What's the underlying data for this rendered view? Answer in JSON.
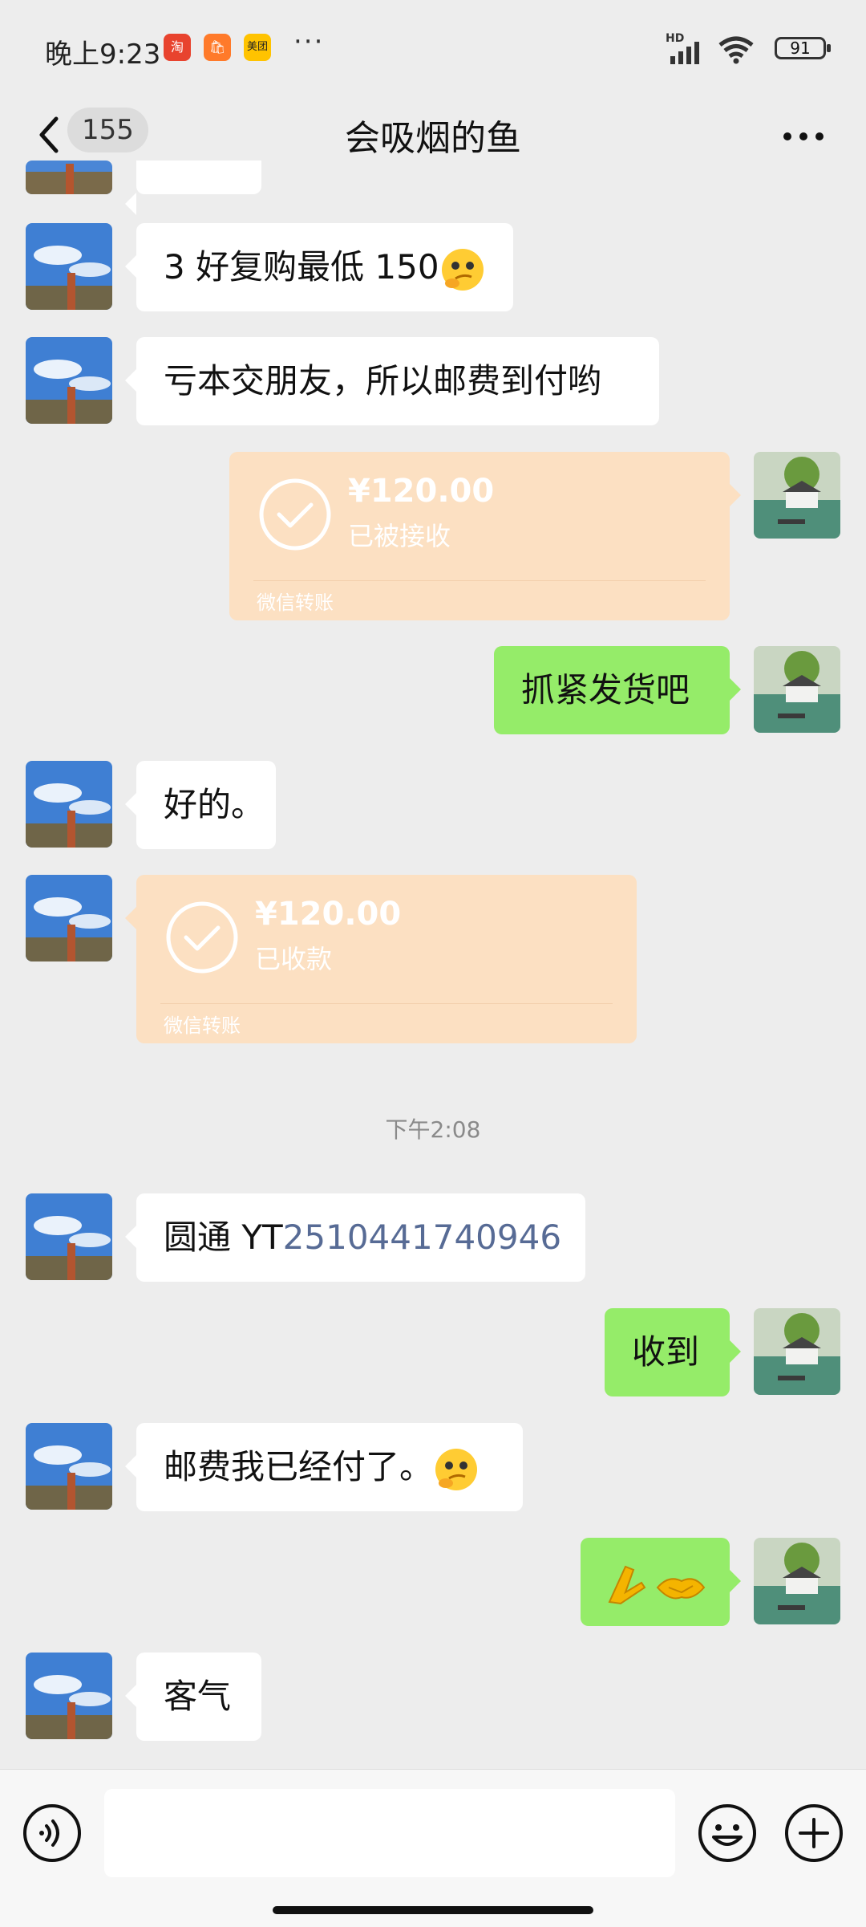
{
  "status_bar": {
    "time": "晚上9:23",
    "apps": [
      "淘",
      "🛍",
      "美团"
    ],
    "network": "HD",
    "battery": "91"
  },
  "nav": {
    "unread_count": "155",
    "title": "会吸烟的鱼"
  },
  "messages": [
    {
      "side": "left",
      "type": "text",
      "text": "3 好复购最低 150",
      "emoji": "smirk-emoji"
    },
    {
      "side": "left",
      "type": "text",
      "text": "亏本交朋友，所以邮费到付哟"
    },
    {
      "side": "right",
      "type": "transfer",
      "amount": "¥120.00",
      "status": "已被接收",
      "label": "微信转账"
    },
    {
      "side": "right",
      "type": "text",
      "text": "抓紧发货吧"
    },
    {
      "side": "left",
      "type": "text",
      "text": "好的。"
    },
    {
      "side": "left",
      "type": "transfer",
      "amount": "¥120.00",
      "status": "已收款",
      "label": "微信转账"
    },
    {
      "side": "left",
      "type": "text",
      "text_prefix": "圆通 YT",
      "link": "2510441740946"
    },
    {
      "side": "right",
      "type": "text",
      "text": "收到"
    },
    {
      "side": "left",
      "type": "text",
      "text": "邮费我已经付了。",
      "emoji": "smirk-emoji"
    },
    {
      "side": "right",
      "type": "emoji",
      "emoji": "pray-handshake-emoji"
    },
    {
      "side": "left",
      "type": "text",
      "text": "客气"
    }
  ],
  "timestamp": "下午2:08",
  "input": {
    "value": "",
    "placeholder": ""
  },
  "colors": {
    "background": "#ededed",
    "sent_bubble": "#95ec69",
    "received_bubble": "#ffffff",
    "transfer_bubble": "#fce0c2",
    "link": "#576b95"
  }
}
